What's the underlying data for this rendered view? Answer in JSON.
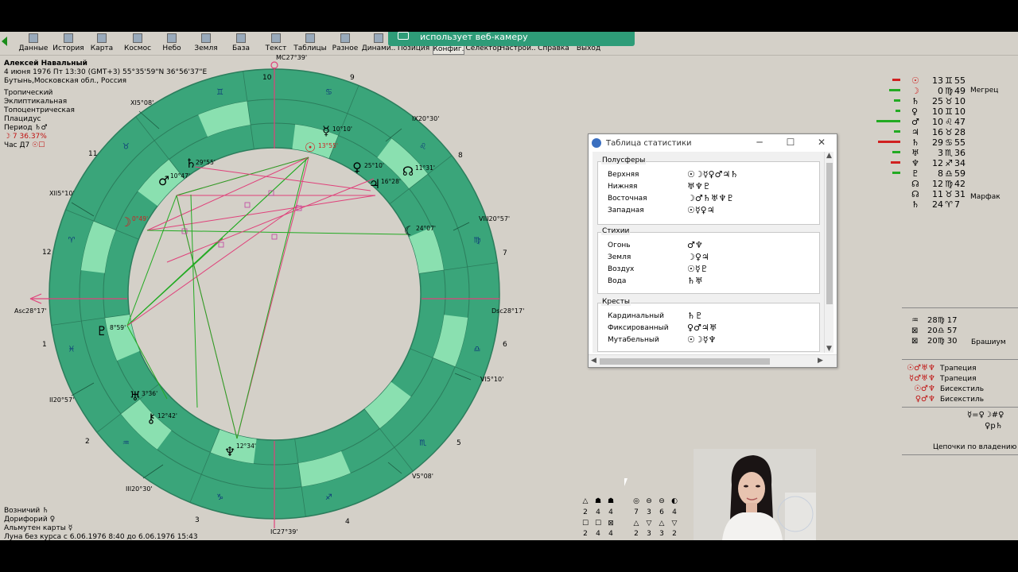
{
  "toolbar": {
    "items": [
      "Данные",
      "История",
      "Карта",
      "Космос",
      "Небо",
      "Земля",
      "База",
      "Текст",
      "Таблицы",
      "Разное",
      "Динами..",
      "Позиция",
      "Конфиг.",
      "Селектор",
      "Настрой..",
      "Справка",
      "Выход"
    ]
  },
  "webcam_banner": "использует веб-камеру",
  "chart_info": {
    "name": "Алексей Навальный",
    "datetime": "4 июня 1976  Пт  13:30 (GMT+3) 55°35'59\"N  36°56'37\"E",
    "place": "Бутынь,Московская обл., Россия",
    "settings": [
      "Тропический",
      "Эклиптикальная",
      "Топоцентрическая",
      "Плацидус"
    ],
    "period_label": "Период",
    "period_symbols": "♄♂",
    "moon_phase": "☽  7 36.37%",
    "hour_label": "Час Д7",
    "hour_symbols": "☉☐"
  },
  "chart": {
    "angles": {
      "mc": "MC27°39'",
      "ic": "IC27°39'",
      "asc": "Asc28°17'",
      "dsc": "Dsc28°17'"
    },
    "cusps": [
      {
        "label": "XI5°08'"
      },
      {
        "label": "XII5°10'"
      },
      {
        "label": "II20°57'"
      },
      {
        "label": "III20°30'"
      },
      {
        "label": "IX20°30'"
      },
      {
        "label": "VIII20°57'"
      },
      {
        "label": "VI5°10'"
      },
      {
        "label": "V5°08'"
      }
    ],
    "house_numbers": [
      "9",
      "10",
      "11",
      "12",
      "1",
      "2",
      "3",
      "4",
      "5",
      "6",
      "7",
      "8"
    ],
    "planets": [
      {
        "glyph": "☿",
        "deg": "10°10'",
        "color": "#000"
      },
      {
        "glyph": "☉",
        "deg": "13°55'",
        "color": "#d02020"
      },
      {
        "glyph": "♄",
        "deg": "29°55'",
        "color": "#000"
      },
      {
        "glyph": "♂",
        "deg": "10°47'",
        "color": "#000"
      },
      {
        "glyph": "♀",
        "deg": "25°10'",
        "color": "#000"
      },
      {
        "glyph": "♃",
        "deg": "16°28'",
        "color": "#000"
      },
      {
        "glyph": "☊",
        "deg": "11°31'",
        "color": "#000"
      },
      {
        "glyph": "☽",
        "deg": "0°49'",
        "color": "#d02020"
      },
      {
        "glyph": "☾",
        "deg": "24°07'",
        "color": "#000"
      },
      {
        "glyph": "♇",
        "deg": "8°59'",
        "color": "#000"
      },
      {
        "glyph": "♅",
        "deg": "3°36'",
        "color": "#000"
      },
      {
        "glyph": "⚷",
        "deg": "12°42'",
        "color": "#000"
      },
      {
        "glyph": "♆",
        "deg": "12°34'",
        "color": "#000"
      }
    ],
    "signs": [
      "♊",
      "♋",
      "♌",
      "♍",
      "♎",
      "♏",
      "♐",
      "♑",
      "♒",
      "♓",
      "♈",
      "♉"
    ]
  },
  "bottom_info": [
    {
      "label": "Возничий",
      "sym": "♄"
    },
    {
      "label": "Дорифорий",
      "sym": "♀"
    },
    {
      "label": "Альмутен карты",
      "sym": "☿"
    },
    {
      "label": "Луна без курса с 6.06.1976  8:40 до 6.06.1976 15:43",
      "sym": ""
    }
  ],
  "stats_window": {
    "title": "Таблица статистики",
    "groups": [
      {
        "title": "Полусферы",
        "rows": [
          {
            "label": "Верхняя",
            "symbols": "☉☽☿♀♂♃♄"
          },
          {
            "label": "Нижняя",
            "symbols": "♅♆♇"
          },
          {
            "label": "Восточная",
            "symbols": "☽♂♄♅♆♇"
          },
          {
            "label": "Западная",
            "symbols": "☉☿♀♃"
          }
        ]
      },
      {
        "title": "Стихии",
        "rows": [
          {
            "label": "Огонь",
            "symbols": "♂♆"
          },
          {
            "label": "Земля",
            "symbols": "☽♀♃"
          },
          {
            "label": "Воздух",
            "symbols": "☉☿♇"
          },
          {
            "label": "Вода",
            "symbols": "♄♅"
          }
        ]
      },
      {
        "title": "Кресты",
        "rows": [
          {
            "label": "Кардинальный",
            "symbols": "♄♇"
          },
          {
            "label": "Фиксированный",
            "symbols": "♀♂♃♅"
          },
          {
            "label": "Мутабельный",
            "symbols": "☉☽☿♆"
          }
        ]
      }
    ]
  },
  "right_panel": {
    "positions": [
      {
        "planet": "☉",
        "deg": "13",
        "sign": "♊",
        "min": "55",
        "color": "#d02020",
        "bar": "#d02020"
      },
      {
        "planet": "☽",
        "deg": "0",
        "sign": "♍",
        "min": "49",
        "color": "#d02020",
        "bar": "#22aa22"
      },
      {
        "planet": "♄",
        "deg": "25",
        "sign": "♉",
        "min": "10",
        "color": "#000",
        "bar": "#22aa22"
      },
      {
        "planet": "♀",
        "deg": "10",
        "sign": "♊",
        "min": "10",
        "color": "#000",
        "bar": "#22aa22"
      },
      {
        "planet": "♂",
        "deg": "10",
        "sign": "♌",
        "min": "47",
        "color": "#000",
        "bar": "#22aa22"
      },
      {
        "planet": "♃",
        "deg": "16",
        "sign": "♉",
        "min": "28",
        "color": "#000",
        "bar": "#22aa22"
      },
      {
        "planet": "♄",
        "deg": "29",
        "sign": "♋",
        "min": "55",
        "color": "#000",
        "bar": "#d02020"
      },
      {
        "planet": "♅",
        "deg": "3",
        "sign": "♏",
        "min": "36",
        "color": "#000",
        "bar": "#22aa22"
      },
      {
        "planet": "♆",
        "deg": "12",
        "sign": "♐",
        "min": "34",
        "color": "#000",
        "bar": "#d02020"
      },
      {
        "planet": "♇",
        "deg": "8",
        "sign": "♎",
        "min": "59",
        "color": "#000",
        "bar": "#22aa22"
      },
      {
        "planet": "☊",
        "deg": "12",
        "sign": "♍",
        "min": "42",
        "color": "#000",
        "bar": ""
      },
      {
        "planet": "☊",
        "deg": "11",
        "sign": "♉",
        "min": "31",
        "color": "#000",
        "bar": ""
      },
      {
        "planet": "♄",
        "deg": "24",
        "sign": "♈",
        "min": "7",
        "color": "#000",
        "bar": ""
      }
    ],
    "star1": "Мегрец",
    "star2": "Марфак",
    "extra": [
      {
        "sym": "♒",
        "deg": "28",
        "sign": "♍",
        "min": "17"
      },
      {
        "sym": "⊠",
        "deg": "20",
        "sign": "♎",
        "min": "57"
      },
      {
        "sym": "⊠",
        "deg": "20",
        "sign": "♍",
        "min": "30"
      }
    ],
    "star3": "Брашиум",
    "figures": [
      {
        "sym": "☉♂♅♆",
        "label": "Трапеция"
      },
      {
        "sym": "☿♂♅♆",
        "label": "Трапеция"
      },
      {
        "sym": "☉♂♆",
        "label": "Бисекстиль"
      },
      {
        "sym": "♀♂♆",
        "label": "Бисекстиль"
      }
    ],
    "formula1": "☿=♀☽#♀",
    "formula2": "♀р♄",
    "chains": "Цепочки по владению"
  },
  "bottom_grid": {
    "row1_syms": [
      "△",
      "☗",
      "☗",
      "◎",
      "⊖",
      "⊖",
      "◐"
    ],
    "row1_vals": [
      "2",
      "4",
      "4",
      "7",
      "3",
      "6",
      "4"
    ],
    "row2_syms": [
      "☐",
      "☐",
      "⊠",
      "△",
      "▽",
      "△",
      "▽"
    ],
    "row2_vals": [
      "2",
      "4",
      "4",
      "2",
      "3",
      "3",
      "2"
    ]
  },
  "colors": {
    "wheel_dark": "#3aa57a",
    "wheel_light": "#8ae0b0",
    "chart_bg": "#d4d0c8",
    "aspect_pink": "#e0407a",
    "aspect_green": "#22aa22"
  }
}
